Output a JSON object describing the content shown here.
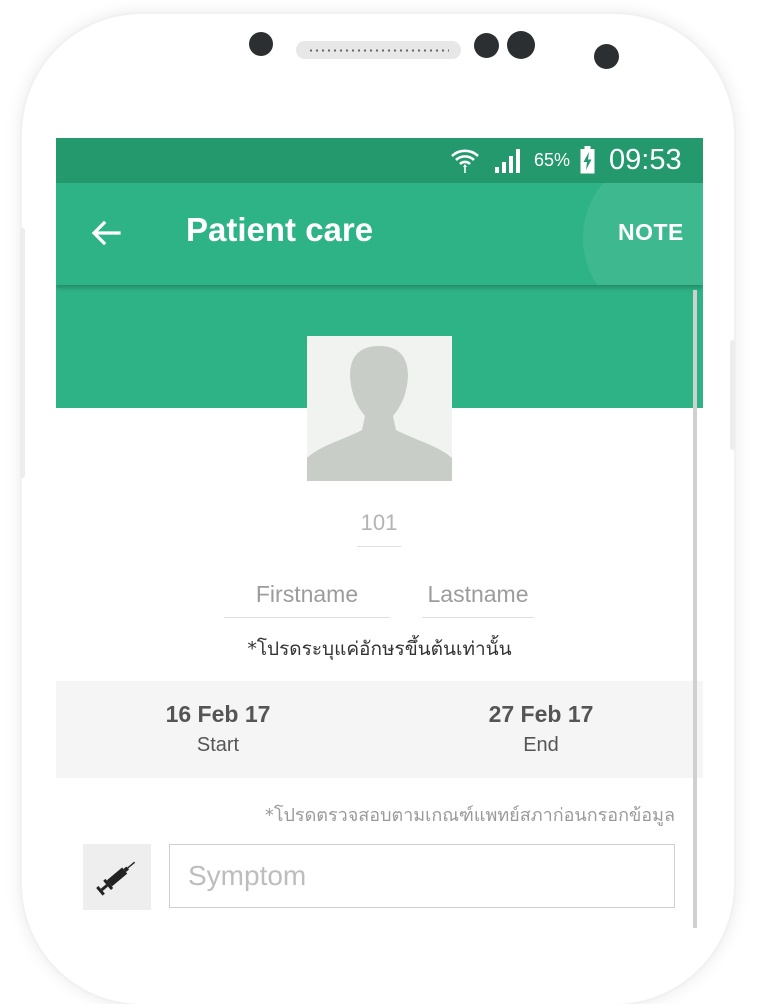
{
  "status_bar": {
    "battery": "65%",
    "time": "09:53"
  },
  "toolbar": {
    "title": "Patient care",
    "note_label": "NOTE"
  },
  "patient": {
    "id": "101",
    "firstname_placeholder": "Firstname",
    "lastname_placeholder": "Lastname",
    "name_note": "*โปรดระบุแค่อักษรขึ้นต้นเท่านั้น"
  },
  "dates": {
    "start": {
      "value": "16 Feb 17",
      "label": "Start"
    },
    "end": {
      "value": "27 Feb 17",
      "label": "End"
    }
  },
  "symptom": {
    "criteria_note": "*โปรดตรวจสอบตามเกณฑ์แพทย์สภาก่อนกรอกข้อมูล",
    "placeholder": "Symptom"
  },
  "colors": {
    "primary": "#2eb386",
    "status_bar": "#24996d"
  },
  "icons": [
    "back-arrow-icon",
    "wifi-icon",
    "signal-icon",
    "battery-charging-icon",
    "avatar-placeholder-icon",
    "syringe-icon"
  ]
}
